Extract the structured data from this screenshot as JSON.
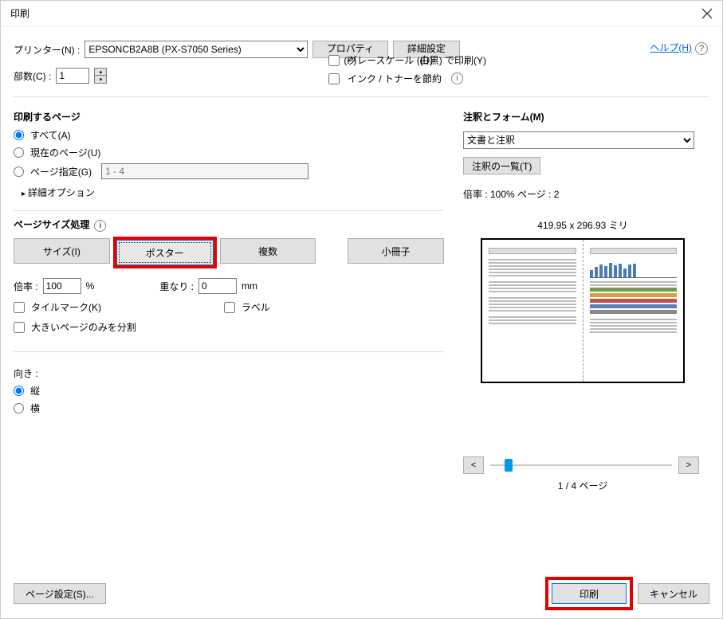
{
  "titlebar": {
    "title": "印刷"
  },
  "help": {
    "label": "ヘルプ(H)"
  },
  "printer": {
    "label": "プリンター(N) :",
    "value": "EPSONCB2A8B (PX-S7050 Series)",
    "properties_btn": "プロパティ(P)",
    "advanced_btn": "詳細設定(D)"
  },
  "copies": {
    "label": "部数(C) :",
    "value": "1"
  },
  "options": {
    "grayscale": "グレースケール (白黒) で印刷(Y)",
    "save_ink": "インク / トナーを節約"
  },
  "pages": {
    "title": "印刷するページ",
    "all": "すべて(A)",
    "current": "現在のページ(U)",
    "range": "ページ指定(G)",
    "range_hint": "1 - 4",
    "advanced": "詳細オプション"
  },
  "sizing": {
    "title": "ページサイズ処理",
    "size": "サイズ(I)",
    "poster": "ポスター",
    "multiple": "複数",
    "booklet": "小冊子",
    "scale_label": "倍率 :",
    "scale_value": "100",
    "scale_unit": "%",
    "overlap_label": "重なり :",
    "overlap_value": "0",
    "overlap_unit": "mm",
    "tile_marks": "タイルマーク(K)",
    "labels": "ラベル",
    "large_only": "大きいページのみを分割"
  },
  "orientation": {
    "title": "向き :",
    "portrait": "縦",
    "landscape": "横"
  },
  "annotations": {
    "title": "注釈とフォーム(M)",
    "value": "文書と注釈",
    "list_btn": "注釈の一覧(T)"
  },
  "preview": {
    "zoom_page": "倍率 : 100% ページ : 2",
    "dimensions": "419.95 x 296.93 ミリ",
    "nav_prev": "<",
    "nav_next": ">",
    "page_of": "1 / 4 ページ"
  },
  "footer": {
    "page_setup": "ページ設定(S)...",
    "print": "印刷",
    "cancel": "キャンセル"
  }
}
